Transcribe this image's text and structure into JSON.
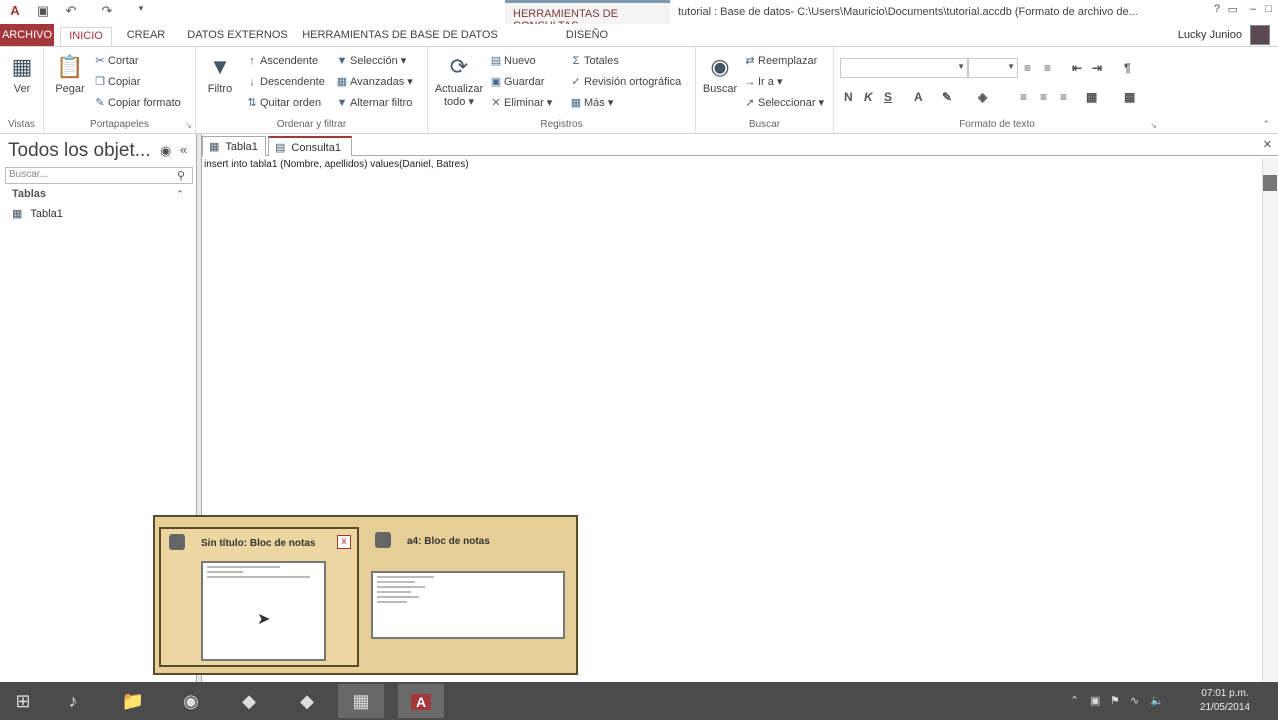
{
  "window": {
    "context_tab_header": "HERRAMIENTAS DE CONSULTAS",
    "document_title": "tutorial : Base de datos- C:\\Users\\Mauricio\\Documents\\tutorial.accdb (Formato de archivo de...",
    "user_name": "Lucky Junioo",
    "minimize": "–",
    "restore": "□",
    "help": "?"
  },
  "tabs": [
    "ARCHIVO",
    "INICIO",
    "CREAR",
    "DATOS EXTERNOS",
    "HERRAMIENTAS DE BASE DE DATOS",
    "DISEÑO"
  ],
  "ribbon": {
    "vistas": {
      "label": "Vistas",
      "ver": "Ver"
    },
    "portapapeles": {
      "label": "Portapapeles",
      "pegar": "Pegar",
      "cortar": "Cortar",
      "copiar": "Copiar",
      "copiar_formato": "Copiar formato"
    },
    "ordenar": {
      "label": "Ordenar y filtrar",
      "filtro": "Filtro",
      "ascendente": "Ascendente",
      "descendente": "Descendente",
      "quitar_orden": "Quitar orden",
      "seleccion": "Selección",
      "avanzadas": "Avanzadas",
      "alternar_filtro": "Alternar filtro"
    },
    "registros": {
      "label": "Registros",
      "actualizar": "Actualizar",
      "todo": "todo",
      "nuevo": "Nuevo",
      "guardar": "Guardar",
      "eliminar": "Eliminar",
      "totales": "Totales",
      "revision": "Revisión ortográfica",
      "mas": "Más"
    },
    "buscar": {
      "label": "Buscar",
      "buscar": "Buscar",
      "reemplazar": "Reemplazar",
      "ir_a": "Ir a",
      "seleccionar": "Seleccionar"
    },
    "formato": {
      "label": "Formato de texto",
      "bold": "N",
      "italic": "K",
      "underline": "S"
    }
  },
  "nav": {
    "title": "Todos los objet...",
    "search_placeholder": "Buscar...",
    "group": "Tablas",
    "items": [
      "Tabla1"
    ]
  },
  "doc_tabs": [
    "Tabla1",
    "Consulta1"
  ],
  "sql": "insert into tabla1 (Nombre, apellidos) values(Daniel, Batres)",
  "popup": {
    "thumbs": [
      {
        "title": "Sin título: Bloc de notas",
        "close": "x"
      },
      {
        "title": "a4: Bloc de notas"
      }
    ]
  },
  "taskbar": {
    "clock_time": "07:01 p.m.",
    "clock_date": "21/05/2014"
  }
}
